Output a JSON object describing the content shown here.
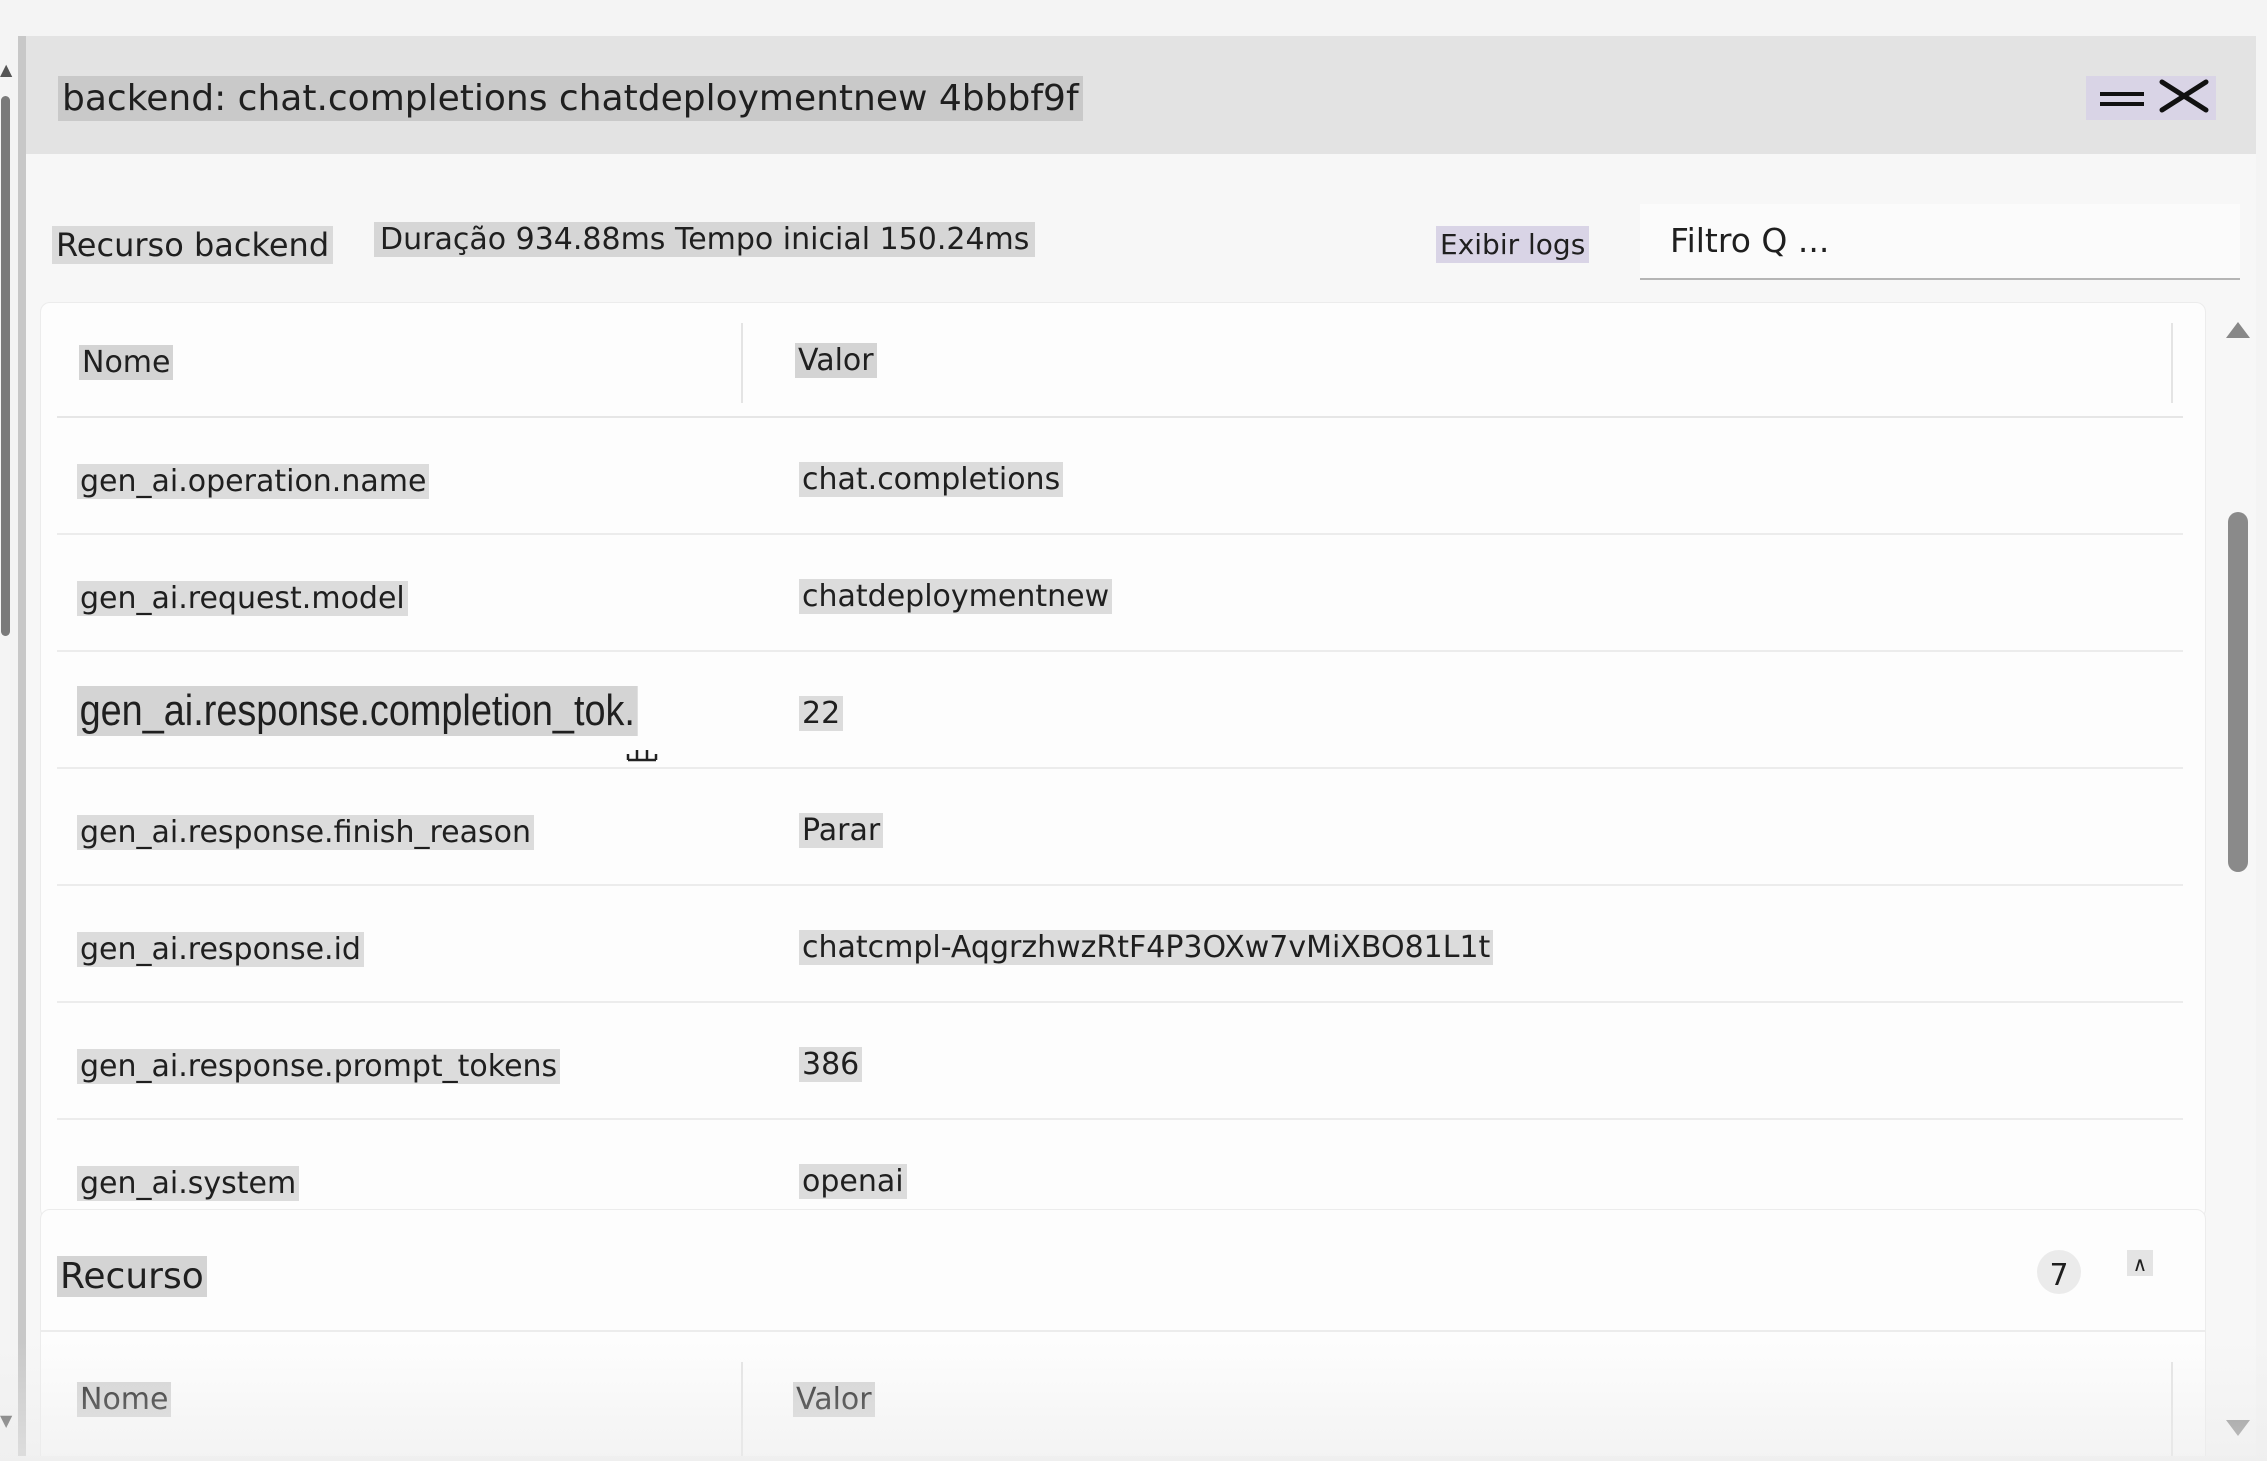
{
  "dialog": {
    "title": "backend: chat.completions chatdeploymentnew 4bbbf9f",
    "minimize_icon": "minimize-icon",
    "close_icon": "close-icon"
  },
  "info": {
    "section_label": "Recurso backend",
    "duration_text": "Duração 934.88ms Tempo inicial 150.24ms",
    "logs_link": "Exibir logs",
    "filter_placeholder": "Filtro Q ..."
  },
  "attributes_table": {
    "headers": {
      "name": "Nome",
      "value": "Valor"
    },
    "rows": [
      {
        "name": "gen_ai.operation.name",
        "value": "chat.completions"
      },
      {
        "name": "gen_ai.request.model",
        "value": "chatdeploymentnew"
      },
      {
        "name": "gen_ai.response.completion_tok.",
        "value": "22"
      },
      {
        "name": "gen_ai.response.finish_reason",
        "value": "Parar"
      },
      {
        "name": "gen_ai.response.id",
        "value": "chatcmpl-AqgrzhwzRtF4P3OXw7vMiXBO81L1t"
      },
      {
        "name": "gen_ai.response.prompt_tokens",
        "value": "386"
      },
      {
        "name": "gen_ai.system",
        "value": "openai"
      }
    ]
  },
  "resource_section": {
    "title": "Recurso",
    "count_badge": "7",
    "collapse_glyph": "∧",
    "headers": {
      "name": "Nome",
      "value": "Valor"
    }
  }
}
